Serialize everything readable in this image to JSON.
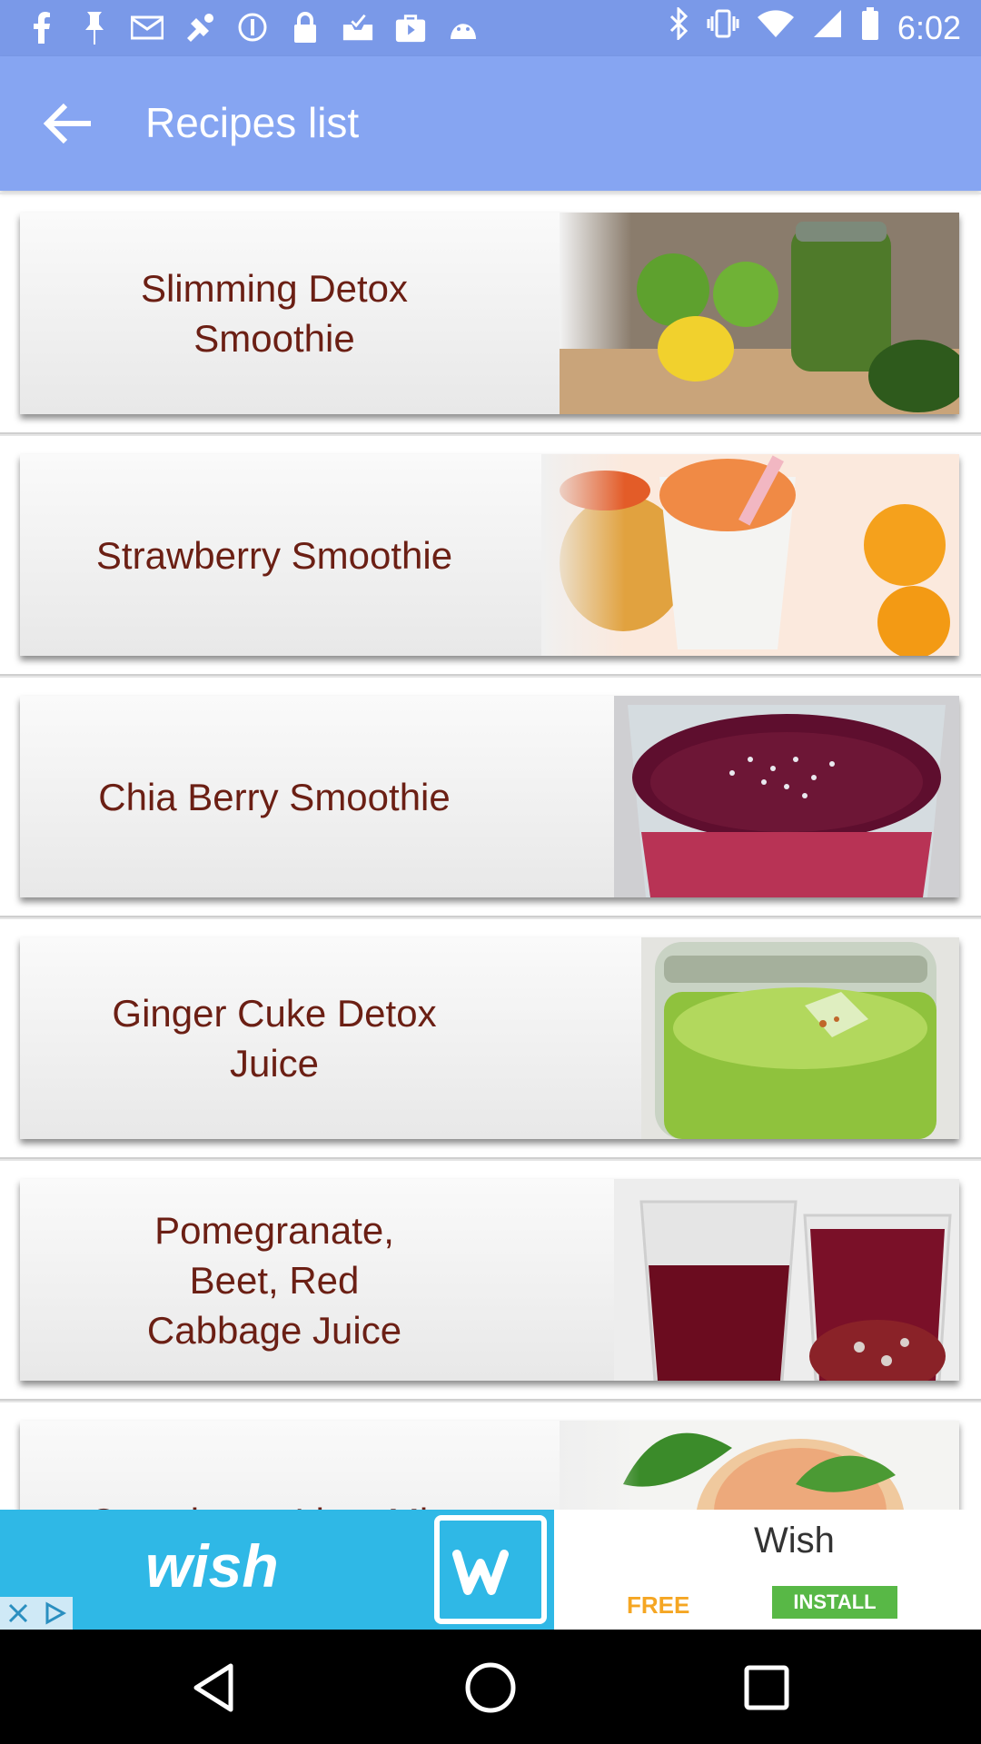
{
  "status_bar": {
    "time": "6:02",
    "notification_icons": [
      "facebook-icon",
      "pin-icon",
      "mail-icon",
      "fake-gps-icon",
      "vpn-icon",
      "lock-icon",
      "inbox-icon",
      "shopping-bag-icon",
      "android-debug-icon"
    ],
    "system_icons": [
      "bluetooth-icon",
      "vibrate-icon",
      "wifi-icon",
      "signal-icon",
      "battery-icon"
    ]
  },
  "app_bar": {
    "title": "Recipes list",
    "back_icon": "arrow-back-icon"
  },
  "recipes": [
    {
      "name": "Slimming Detox Smoothie"
    },
    {
      "name": "Strawberry Smoothie"
    },
    {
      "name": "Chia Berry Smoothie"
    },
    {
      "name": "Ginger Cuke Detox Juice"
    },
    {
      "name": "Pomegranate, Beet, Red Cabbage Juice"
    },
    {
      "name": "Cantaloupe Lime Mint"
    }
  ],
  "ad": {
    "brand_text": "wish",
    "app_name": "Wish",
    "price": "FREE",
    "install_label": "INSTALL"
  },
  "nav_bar": {
    "icons": [
      "back-triangle-icon",
      "home-circle-icon",
      "recents-square-icon"
    ]
  },
  "colors": {
    "app_bar": "#86a5f2",
    "status_bar": "#7a99e8",
    "recipe_text": "#6b1f14",
    "ad_blue": "#2fb8e6",
    "install_green": "#58b846"
  }
}
